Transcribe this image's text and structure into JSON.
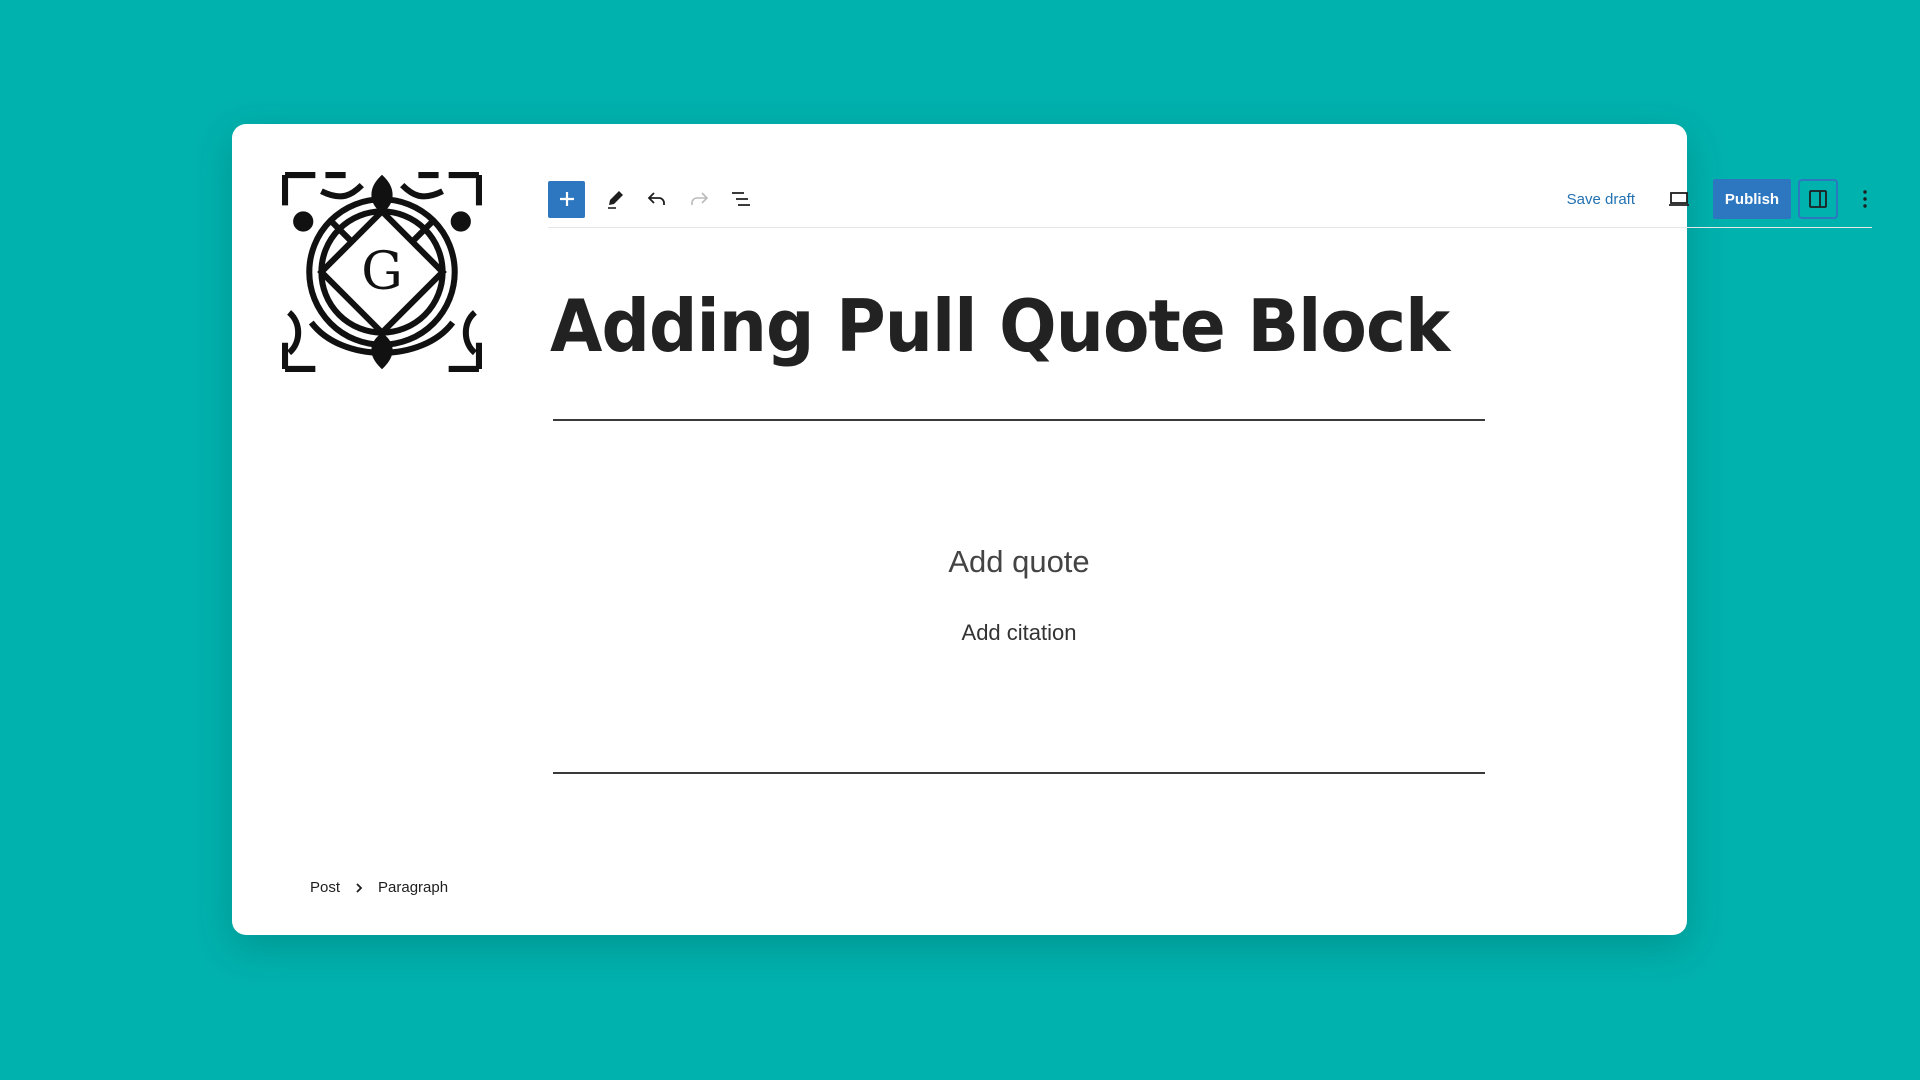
{
  "colors": {
    "background": "#00b2ae",
    "accent": "#2d77c0",
    "link": "#2271b1"
  },
  "logo": {
    "icon": "gutenberg-logo-icon",
    "letter": "G"
  },
  "toolbar": {
    "left": [
      {
        "name": "add-block-button",
        "icon": "plus-icon",
        "label": "Add block"
      },
      {
        "name": "tools-button",
        "icon": "pencil-icon",
        "label": "Tools"
      },
      {
        "name": "undo-button",
        "icon": "undo-icon",
        "label": "Undo"
      },
      {
        "name": "redo-button",
        "icon": "redo-icon",
        "label": "Redo",
        "disabled": true
      },
      {
        "name": "document-overview-button",
        "icon": "list-view-icon",
        "label": "Document overview"
      }
    ],
    "save_draft_label": "Save draft",
    "preview_icon": "desktop-preview-icon",
    "publish_label": "Publish",
    "settings_icon": "sidebar-toggle-icon",
    "more_icon": "more-vertical-icon"
  },
  "post": {
    "title": "Adding Pull Quote Block",
    "pullquote": {
      "quote_placeholder": "Add quote",
      "citation_placeholder": "Add citation"
    }
  },
  "breadcrumb": {
    "items": [
      "Post",
      "Paragraph"
    ],
    "separator_icon": "chevron-right-icon"
  }
}
